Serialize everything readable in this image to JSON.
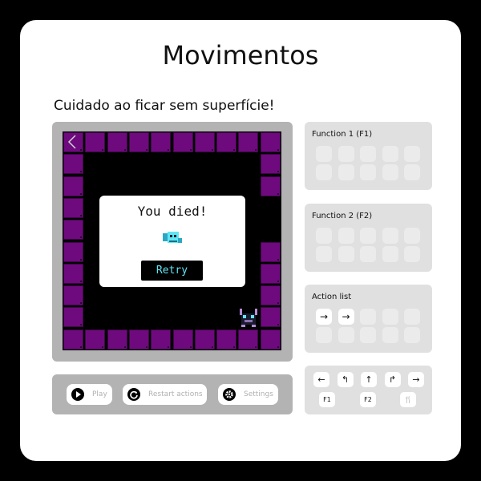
{
  "title": "Movimentos",
  "subtitle": "Cuidado ao ficar sem superfície!",
  "colors": {
    "tile": "#6e0a7e",
    "board_bg": "#000000",
    "retry_text": "#5fe6f5",
    "frame": "#b3b3b3",
    "panel": "#e0e0e0"
  },
  "game": {
    "back_icon": "chevron-left-icon",
    "dialog": {
      "title": "You died!",
      "icon": "dead-robot-icon",
      "retry_label": "Retry"
    },
    "player_icon": "robot-icon"
  },
  "controls": {
    "play_label": "Play",
    "restart_label": "Restart actions",
    "settings_label": "Settings"
  },
  "panels": {
    "function1": {
      "title": "Function 1 (F1)",
      "slots": [
        "",
        "",
        "",
        "",
        "",
        "",
        "",
        "",
        "",
        ""
      ]
    },
    "function2": {
      "title": "Function 2 (F2)",
      "slots": [
        "",
        "",
        "",
        "",
        "",
        "",
        "",
        "",
        "",
        ""
      ]
    },
    "action_list": {
      "title": "Action list",
      "slots": [
        "→",
        "→",
        "",
        "",
        "",
        "",
        "",
        "",
        "",
        ""
      ]
    }
  },
  "keypad": {
    "row1": [
      "←",
      "↰",
      "↑",
      "↱",
      "→"
    ],
    "row2": [
      "F1",
      "F2",
      "🍴"
    ]
  }
}
